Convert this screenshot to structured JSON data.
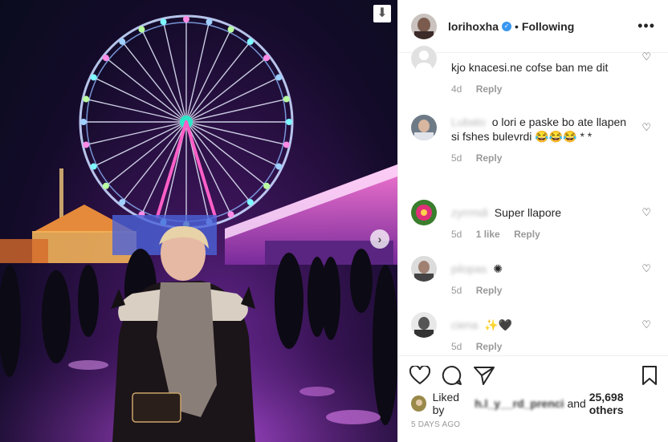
{
  "post": {
    "username": "lorihoxha",
    "separator": "•",
    "follow_status": "Following",
    "more_glyph": "•••",
    "download_glyph": "⬇",
    "next_glyph": "›"
  },
  "comments": [
    {
      "user": "",
      "text": "kjo knacesi.ne cofse ban me dit",
      "age": "4d",
      "likes": "",
      "reply": "Reply"
    },
    {
      "user": "Lubato",
      "text": "o lori e paske bo ate llapen si fshes bulevrdi 😂😂😂 * *",
      "age": "5d",
      "likes": "",
      "reply": "Reply"
    },
    {
      "user": "zyrrmdi",
      "text": "Super llapore",
      "age": "5d",
      "likes": "1 like",
      "reply": "Reply"
    },
    {
      "user": "pilopas",
      "text": "",
      "age": "5d",
      "likes": "",
      "reply": "Reply"
    },
    {
      "user": "ciena",
      "text": "",
      "age": "5d",
      "likes": "",
      "reply": "Reply"
    }
  ],
  "footer": {
    "liked_by_prefix": "Liked by",
    "liked_user": "h.l_y__rd_prenci",
    "liked_suffix_and": "and",
    "likes_count": "25,698 others",
    "timestamp": "5 DAYS AGO"
  }
}
